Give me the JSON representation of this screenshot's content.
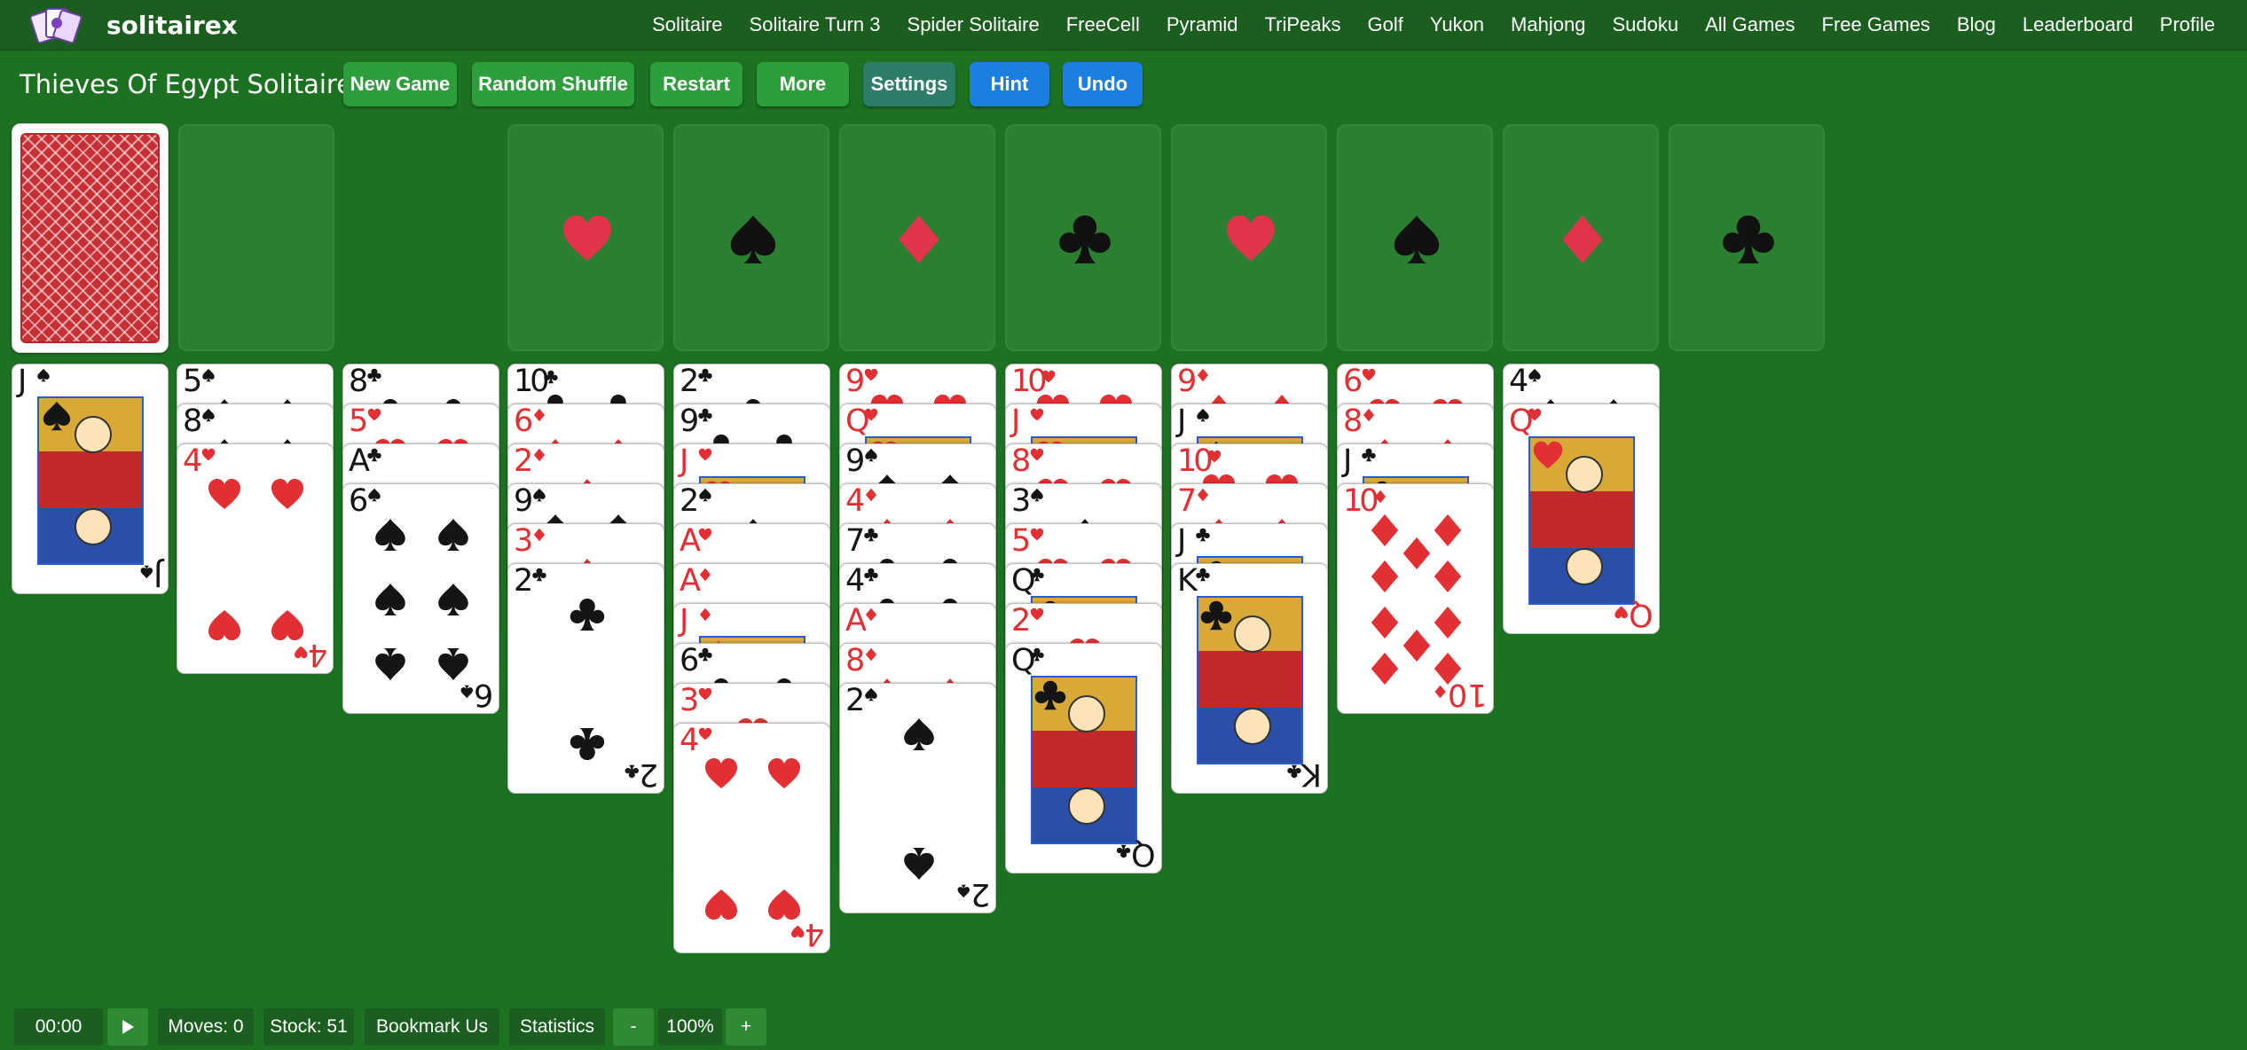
{
  "brand": {
    "name": "solitairex",
    "logo_icon": "cards-logo-icon"
  },
  "nav": [
    "Solitaire",
    "Solitaire Turn 3",
    "Spider Solitaire",
    "FreeCell",
    "Pyramid",
    "TriPeaks",
    "Golf",
    "Yukon",
    "Mahjong",
    "Sudoku",
    "All Games",
    "Free Games",
    "Blog",
    "Leaderboard",
    "Profile"
  ],
  "game_title": "Thieves Of Egypt Solitaire",
  "toolbar": {
    "new_game": "New Game",
    "random_shuffle": "Random Shuffle",
    "restart": "Restart",
    "more": "More",
    "settings": "Settings",
    "hint": "Hint",
    "undo": "Undo"
  },
  "colors": {
    "felt": "#1d7222",
    "header": "#1b5e20",
    "button_green": "#2e9e3c",
    "button_teal": "#2b7d6a",
    "button_blue": "#1b7fe0",
    "red_suit": "#e22f33",
    "black_suit": "#151515"
  },
  "foundations": [
    "heart",
    "spade",
    "diamond",
    "club",
    "heart",
    "spade",
    "diamond",
    "club"
  ],
  "tableau": [
    [
      "J♠"
    ],
    [
      "5♠",
      "8♠",
      "4♥"
    ],
    [
      "8♣",
      "5♥",
      "A♣",
      "6♠"
    ],
    [
      "10♣",
      "6♦",
      "2♦",
      "9♠",
      "3♦",
      "2♣"
    ],
    [
      "2♣",
      "9♣",
      "J♥",
      "2♠",
      "A♥",
      "A♦",
      "J♦",
      "6♣",
      "3♥",
      "4♥"
    ],
    [
      "9♥",
      "Q♥",
      "9♠",
      "4♦",
      "7♣",
      "4♣",
      "A♦",
      "8♦",
      "2♠"
    ],
    [
      "10♥",
      "J♥",
      "8♥",
      "3♠",
      "5♥",
      "Q♣",
      "2♥",
      "Q♣"
    ],
    [
      "9♦",
      "J♠",
      "10♥",
      "7♦",
      "J♣",
      "K♣"
    ],
    [
      "6♥",
      "8♦",
      "J♣",
      "10♦"
    ],
    [
      "4♠",
      "Q♥"
    ]
  ],
  "footer": {
    "timer": "00:00",
    "play_icon": "play-icon",
    "moves": "Moves: 0",
    "stock": "Stock: 51",
    "bookmark": "Bookmark Us",
    "statistics": "Statistics",
    "zoom_out": "-",
    "zoom": "100%",
    "zoom_in": "+"
  }
}
